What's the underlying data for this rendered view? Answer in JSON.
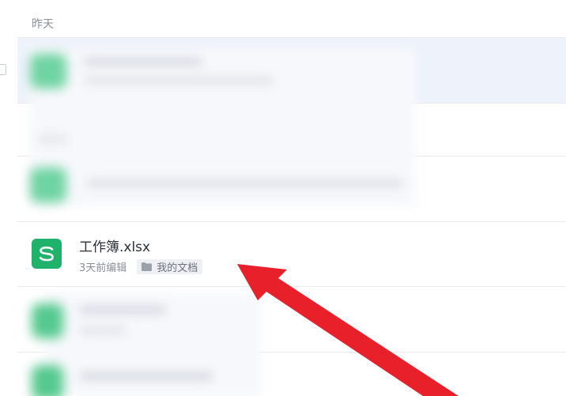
{
  "section": {
    "header": "昨天"
  },
  "files": [
    {
      "name": "工作簿.xlsx",
      "meta": "3天前编辑",
      "folder": "我的文档",
      "icon": "spreadsheet-s-icon",
      "icon_color": "#1fb26b"
    }
  ],
  "annotation": {
    "arrow_color": "#e8202a"
  }
}
